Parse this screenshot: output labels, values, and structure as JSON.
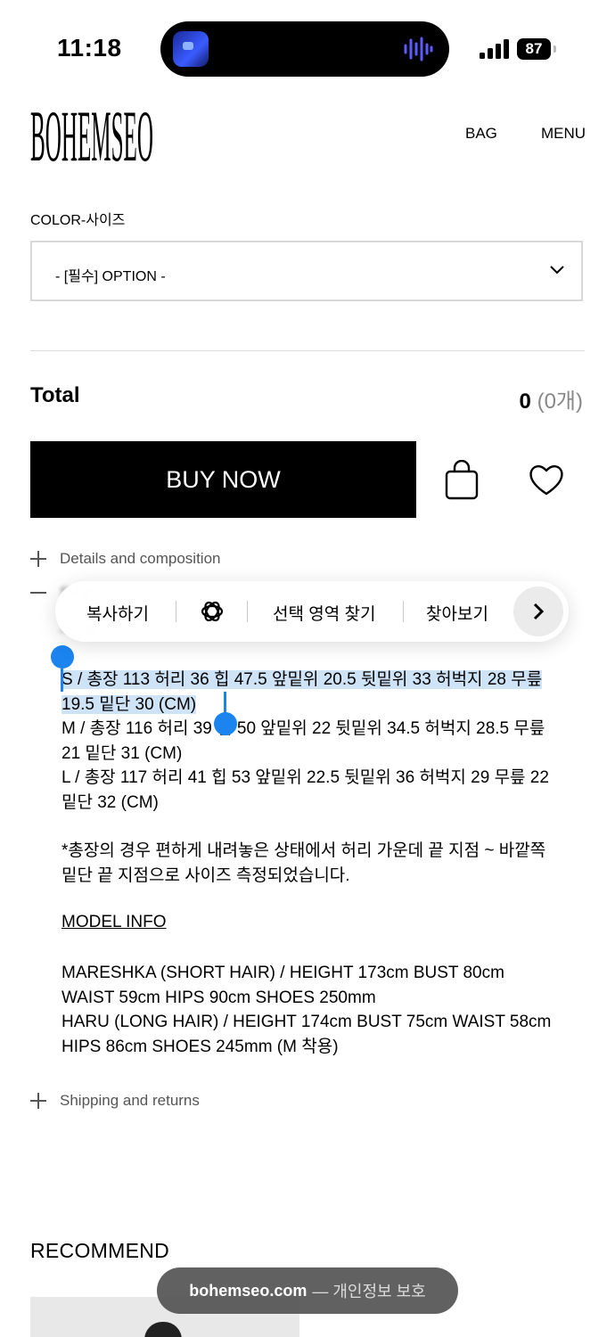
{
  "status_bar": {
    "time": "11:18",
    "battery": "87"
  },
  "header": {
    "logo": "BOHEMSEO",
    "bag_label": "BAG",
    "menu_label": "MENU"
  },
  "option": {
    "label": "COLOR-사이즈",
    "selected": "- [필수] OPTION -"
  },
  "total": {
    "label": "Total",
    "value": "0",
    "count": "(0개)"
  },
  "actions": {
    "buy_label": "BUY NOW"
  },
  "accordion": {
    "details_label": "Details and composition",
    "shipping_label": "Shipping and returns"
  },
  "context_menu": {
    "copy": "복사하기",
    "find_selection": "선택 영역 찾기",
    "look_up": "찾아보기"
  },
  "product_info": {
    "size_s_selected": "S / 총장 113 허리 36 힙 47.5 앞밑위 20.5 뒷밑위 33 허벅지 28 무릎 19.5 밑단 30 (CM)",
    "size_m": "M / 총장 116 허리 39 힙 50 앞밑위 22 뒷밑위 34.5 허벅지 28.5 무릎 21 밑단 31 (CM)",
    "size_l": "L / 총장 117 허리 41 힙 53 앞밑위 22.5 뒷밑위 36 허벅지 29 무릎 22 밑단 32 (CM)",
    "note": "*총장의 경우 편하게 내려놓은 상태에서 허리 가운데 끝 지점 ~ 바깥쪽 밑단 끝 지점으로 사이즈 측정되었습니다.",
    "model_heading": "MODEL INFO",
    "model_1": "MARESHKA (SHORT HAIR) / HEIGHT 173cm BUST 80cm WAIST 59cm HIPS 90cm SHOES 250mm",
    "model_2": "HARU (LONG HAIR) / HEIGHT 174cm BUST 75cm WAIST 58cm HIPS 86cm SHOES 245mm (M 착용)"
  },
  "recommend": {
    "title": "RECOMMEND"
  },
  "toast": {
    "domain": "bohemseo.com",
    "rest": "— 개인정보 보호"
  },
  "colors": {
    "selection": "#cfe3f7",
    "handle": "#1b84ee",
    "buy_button": "#000000"
  }
}
